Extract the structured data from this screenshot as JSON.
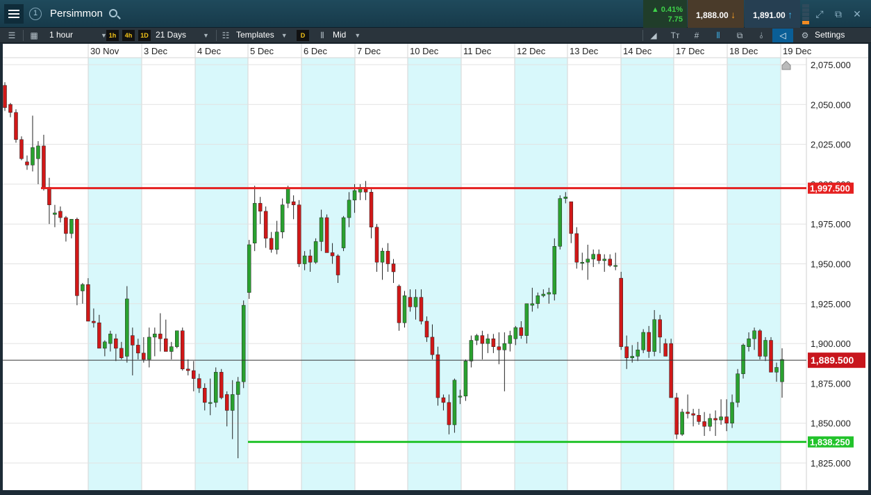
{
  "header": {
    "title": "Persimmon",
    "change_percent": "0.41%",
    "change_points": "7.75",
    "sell_price": "1,888.00",
    "buy_price": "1,891.00"
  },
  "toolbar": {
    "interval": "1 hour",
    "quick_1": "1h",
    "quick_2": "4h",
    "quick_3": "1D",
    "range": "21 Days",
    "templates": "Templates",
    "d_label": "D",
    "price_type": "Mid",
    "settings": "Settings"
  },
  "colors": {
    "up": "#2aa12f",
    "down": "#d01818",
    "resistance": "#e52020",
    "support": "#22c32b",
    "session_shade": "#d8f8fb"
  },
  "chart_data": {
    "type": "candlestick",
    "instrument": "Persimmon",
    "interval": "1 hour",
    "x_labels": [
      "30 Nov",
      "3 Dec",
      "4 Dec",
      "5 Dec",
      "6 Dec",
      "7 Dec",
      "10 Dec",
      "11 Dec",
      "12 Dec",
      "13 Dec",
      "14 Dec",
      "17 Dec",
      "18 Dec",
      "19 Dec"
    ],
    "y_ticks": [
      "2,075.000",
      "2,050.000",
      "2,025.000",
      "2,000.000",
      "1,975.000",
      "1,950.000",
      "1,925.000",
      "1,900.000",
      "1,875.000",
      "1,850.000",
      "1,825.000"
    ],
    "ylim": [
      1813,
      2082
    ],
    "resistance_level": 1997.5,
    "resistance_label": "1,997.500",
    "support_level": 1838.25,
    "support_label": "1,838.250",
    "last_price": 1889.5,
    "last_price_label": "1,889.500",
    "candles": [
      [
        2062,
        2064,
        2046,
        2048
      ],
      [
        2050,
        2051,
        2042,
        2045
      ],
      [
        2045,
        2047,
        2026,
        2028
      ],
      [
        2028,
        2030,
        2015,
        2016
      ],
      [
        2014,
        2018,
        2009,
        2012
      ],
      [
        2012,
        2043,
        2008,
        2023
      ],
      [
        2016,
        2027,
        2000,
        2024
      ],
      [
        2024,
        2031,
        1996,
        1998
      ],
      [
        1998,
        2004,
        1975,
        1987
      ],
      [
        1981,
        1987,
        1973,
        1982
      ],
      [
        1983,
        1986,
        1976,
        1979
      ],
      [
        1979,
        1980,
        1964,
        1969
      ],
      [
        1969,
        1974,
        1966,
        1978
      ],
      [
        1978,
        1979,
        1924,
        1930
      ],
      [
        1933,
        1938,
        1925,
        1937
      ],
      [
        1937,
        1941,
        1914,
        1914
      ],
      [
        1914,
        1922,
        1910,
        1913
      ],
      [
        1913,
        1918,
        1897,
        1897
      ],
      [
        1897,
        1902,
        1892,
        1901
      ],
      [
        1900,
        1908,
        1895,
        1906
      ],
      [
        1903,
        1906,
        1889,
        1897
      ],
      [
        1897,
        1901,
        1890,
        1891
      ],
      [
        1892,
        1936,
        1888,
        1928
      ],
      [
        1905,
        1910,
        1880,
        1899
      ],
      [
        1899,
        1903,
        1890,
        1894
      ],
      [
        1894,
        1904,
        1888,
        1890
      ],
      [
        1890,
        1910,
        1885,
        1904
      ],
      [
        1904,
        1910,
        1892,
        1906
      ],
      [
        1906,
        1919,
        1895,
        1903
      ],
      [
        1903,
        1915,
        1896,
        1895
      ],
      [
        1895,
        1901,
        1890,
        1898
      ],
      [
        1898,
        1908,
        1897,
        1908
      ],
      [
        1908,
        1910,
        1883,
        1884
      ],
      [
        1884,
        1890,
        1880,
        1883
      ],
      [
        1883,
        1889,
        1870,
        1878
      ],
      [
        1878,
        1881,
        1869,
        1872
      ],
      [
        1872,
        1875,
        1858,
        1863
      ],
      [
        1863,
        1878,
        1855,
        1863
      ],
      [
        1863,
        1885,
        1860,
        1882
      ],
      [
        1882,
        1884,
        1865,
        1866
      ],
      [
        1868,
        1870,
        1848,
        1858
      ],
      [
        1858,
        1877,
        1840,
        1868
      ],
      [
        1868,
        1879,
        1828,
        1876
      ],
      [
        1876,
        1927,
        1872,
        1924
      ],
      [
        1932,
        1965,
        1928,
        1962
      ],
      [
        1963,
        1999,
        1958,
        1988
      ],
      [
        1988,
        1992,
        1975,
        1983
      ],
      [
        1983,
        1986,
        1960,
        1966
      ],
      [
        1966,
        1970,
        1957,
        1959
      ],
      [
        1959,
        1977,
        1956,
        1970
      ],
      [
        1970,
        1991,
        1966,
        1987
      ],
      [
        1988,
        1999,
        1985,
        1997
      ],
      [
        1989,
        1993,
        1978,
        1987
      ],
      [
        1987,
        1990,
        1948,
        1950
      ],
      [
        1950,
        1958,
        1946,
        1955
      ],
      [
        1955,
        1959,
        1945,
        1951
      ],
      [
        1951,
        1966,
        1950,
        1964
      ],
      [
        1964,
        1984,
        1958,
        1979
      ],
      [
        1979,
        1981,
        1963,
        1957
      ],
      [
        1957,
        1963,
        1950,
        1955
      ],
      [
        1955,
        1956,
        1938,
        1943
      ],
      [
        1960,
        1980,
        1958,
        1979
      ],
      [
        1979,
        1995,
        1973,
        1990
      ],
      [
        1990,
        2000,
        1982,
        1996
      ],
      [
        1995,
        2000,
        1990,
        1998
      ],
      [
        1998,
        2002,
        1990,
        1995
      ],
      [
        1995,
        1997,
        1966,
        1973
      ],
      [
        1973,
        1975,
        1945,
        1951
      ],
      [
        1951,
        1960,
        1940,
        1958
      ],
      [
        1958,
        1963,
        1945,
        1950
      ],
      [
        1950,
        1953,
        1938,
        1945
      ],
      [
        1936,
        1937,
        1908,
        1913
      ],
      [
        1913,
        1933,
        1910,
        1930
      ],
      [
        1929,
        1934,
        1920,
        1923
      ],
      [
        1923,
        1934,
        1915,
        1929
      ],
      [
        1929,
        1934,
        1912,
        1914
      ],
      [
        1914,
        1917,
        1901,
        1904
      ],
      [
        1904,
        1912,
        1890,
        1893
      ],
      [
        1893,
        1898,
        1861,
        1866
      ],
      [
        1866,
        1868,
        1858,
        1863
      ],
      [
        1863,
        1868,
        1843,
        1849
      ],
      [
        1849,
        1878,
        1844,
        1877
      ],
      [
        1867,
        1871,
        1862,
        1867
      ],
      [
        1867,
        1890,
        1864,
        1889
      ],
      [
        1889,
        1905,
        1885,
        1902
      ],
      [
        1902,
        1906,
        1899,
        1905
      ],
      [
        1905,
        1908,
        1890,
        1900
      ],
      [
        1900,
        1906,
        1894,
        1903
      ],
      [
        1903,
        1906,
        1894,
        1898
      ],
      [
        1898,
        1907,
        1887,
        1896
      ],
      [
        1896,
        1907,
        1870,
        1900
      ],
      [
        1900,
        1908,
        1895,
        1905
      ],
      [
        1903,
        1911,
        1899,
        1910
      ],
      [
        1910,
        1914,
        1903,
        1905
      ],
      [
        1905,
        1925,
        1900,
        1925
      ],
      [
        1924,
        1935,
        1920,
        1925
      ],
      [
        1925,
        1932,
        1922,
        1930
      ],
      [
        1930,
        1934,
        1929,
        1931
      ],
      [
        1931,
        1935,
        1925,
        1932
      ],
      [
        1931,
        1966,
        1927,
        1961
      ],
      [
        1961,
        1993,
        1959,
        1991
      ],
      [
        1991,
        1995,
        1988,
        1992
      ],
      [
        1989,
        1989,
        1963,
        1969
      ],
      [
        1969,
        1973,
        1947,
        1951
      ],
      [
        1951,
        1957,
        1946,
        1951
      ],
      [
        1951,
        1962,
        1940,
        1953
      ],
      [
        1953,
        1959,
        1948,
        1956
      ],
      [
        1956,
        1959,
        1950,
        1952
      ],
      [
        1952,
        1956,
        1945,
        1953
      ],
      [
        1953,
        1956,
        1948,
        1949
      ],
      [
        1949,
        1957,
        1946,
        1949
      ],
      [
        1941,
        1945,
        1896,
        1898
      ],
      [
        1898,
        1905,
        1884,
        1891
      ],
      [
        1891,
        1899,
        1888,
        1892
      ],
      [
        1892,
        1901,
        1889,
        1896
      ],
      [
        1896,
        1909,
        1894,
        1907
      ],
      [
        1907,
        1911,
        1891,
        1895
      ],
      [
        1895,
        1921,
        1892,
        1915
      ],
      [
        1915,
        1918,
        1894,
        1904
      ],
      [
        1900,
        1903,
        1892,
        1892
      ],
      [
        1900,
        1903,
        1866,
        1866
      ],
      [
        1866,
        1869,
        1840,
        1843
      ],
      [
        1843,
        1859,
        1842,
        1857
      ],
      [
        1857,
        1868,
        1853,
        1856
      ],
      [
        1856,
        1859,
        1848,
        1855
      ],
      [
        1855,
        1859,
        1849,
        1851
      ],
      [
        1851,
        1857,
        1842,
        1848
      ],
      [
        1848,
        1856,
        1845,
        1853
      ],
      [
        1853,
        1858,
        1842,
        1852
      ],
      [
        1852,
        1865,
        1849,
        1854
      ],
      [
        1854,
        1865,
        1845,
        1850
      ],
      [
        1850,
        1868,
        1847,
        1863
      ],
      [
        1863,
        1884,
        1860,
        1881
      ],
      [
        1881,
        1900,
        1878,
        1899
      ],
      [
        1898,
        1907,
        1895,
        1903
      ],
      [
        1903,
        1910,
        1896,
        1908
      ],
      [
        1908,
        1909,
        1890,
        1892
      ],
      [
        1892,
        1904,
        1889,
        1902
      ],
      [
        1902,
        1904,
        1882,
        1882
      ],
      [
        1882,
        1888,
        1876,
        1885
      ],
      [
        1876,
        1897,
        1866,
        1890
      ]
    ]
  }
}
